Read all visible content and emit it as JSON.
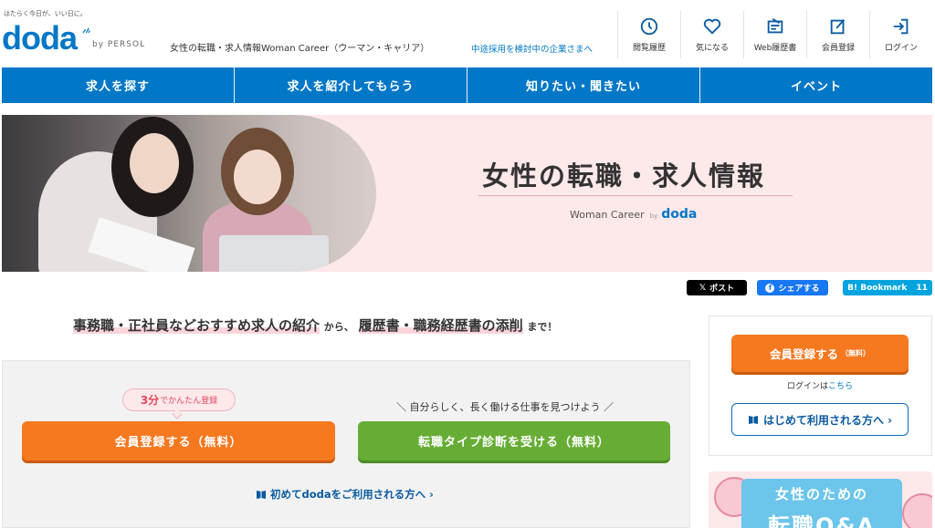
{
  "header": {
    "tagline": "はたらく今日が、いい日に。",
    "logo": "doda",
    "by_persol": "by PERSOL",
    "site_desc": "女性の転職・求人情報Woman Career（ウーマン・キャリア）",
    "corp_link": "中途採用を検討中の企業さまへ",
    "icons": [
      {
        "label": "閲覧履歴",
        "icon": "clock-icon"
      },
      {
        "label": "気になる",
        "icon": "heart-icon"
      },
      {
        "label": "Web履歴書",
        "icon": "resume-icon"
      },
      {
        "label": "会員登録",
        "icon": "edit-icon"
      },
      {
        "label": "ログイン",
        "icon": "login-icon"
      }
    ]
  },
  "nav": {
    "items": [
      "求人を探す",
      "求人を紹介してもらう",
      "知りたい・聞きたい",
      "イベント"
    ]
  },
  "hero": {
    "title": "女性の転職・求人情報",
    "sub": "Woman Career",
    "by": "by",
    "brand": "doda"
  },
  "share": {
    "x": "ポスト",
    "facebook": "シェアする",
    "hatena": "B! Bookmark",
    "hatena_count": "11"
  },
  "lead": {
    "hl1": "事務職・正社員などおすすめ求人の紹介",
    "mid": "から、",
    "hl2": "履歴書・職務経歴書の添削",
    "end": "まで！"
  },
  "cta": {
    "badge_main": "3分",
    "badge_sub": "でかんたん登録",
    "catch": "＼ 自分らしく、長く働ける仕事を見つけよう ／",
    "register": "会員登録する（無料）",
    "diagnosis": "転職タイプ診断を受ける（無料）",
    "first_time": "初めてdodaをご利用される方へ ›"
  },
  "side": {
    "register": "会員登録する",
    "register_note": "（無料）",
    "login_prefix": "ログインは",
    "login_link": "こちら",
    "first": "はじめて利用される方へ ›"
  },
  "banner": {
    "line1": "女性のための",
    "line2": "転職Q&A"
  },
  "colors": {
    "brand": "#0077c7",
    "orange": "#f6781f",
    "green": "#67ad35",
    "pink": "#fde8ea"
  }
}
